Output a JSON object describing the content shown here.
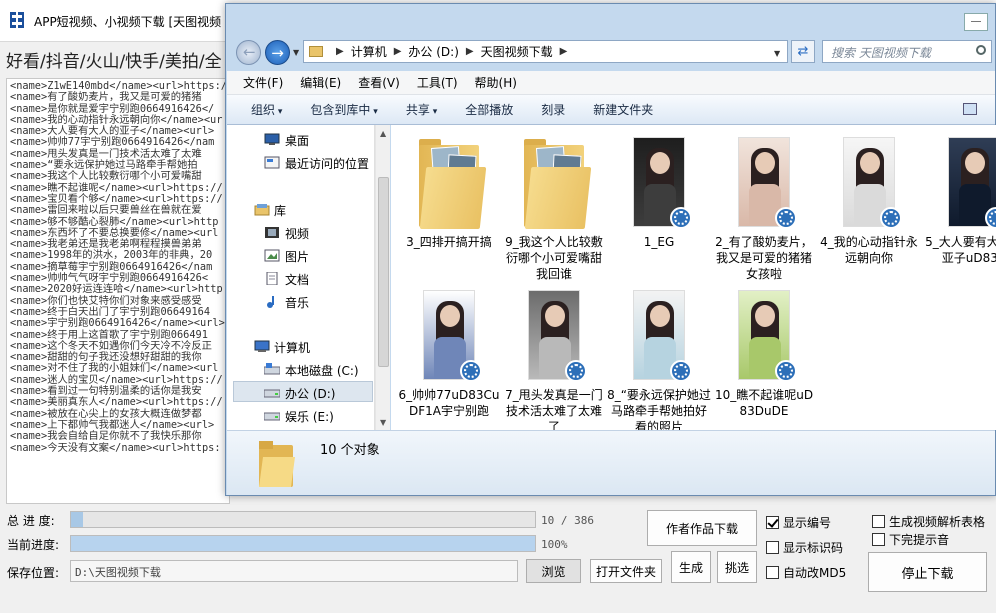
{
  "app": {
    "title": "APP短视频、小视频下载 [天图视频",
    "platforms": "好看/抖音/火山/快手/美拍/全",
    "log_lines": [
      "<name>Z1wE140mbd</name><url>https://",
      "<name>有了酸奶麦片，我又是可爱的猪猪",
      "<name>是你就是爱宇宁别跑0664916426</",
      "<name>我的心动指针永远朝向你</name><ur",
      "<name>大人要有大人的亚子</name><url>",
      "<name>帅帅77宇宁别跑0664916426</nam",
      "<name>甩头发真是一门技术活太难了太难",
      "<name>“要永远保护她过马路牵手帮她拍",
      "<name>我这个人比较敷衍哪个小可爱嘴甜",
      "<name>瞧不起谁呢</name><url>https://",
      "<name>宝贝看个够</name><url>https://",
      "<name>雷回来啦以后只要兽丝在兽就在爱",
      "<name>够不够酷心裂肺</name><url>http",
      "<name>东西坏了不要总换要修</name><url",
      "<name>我老弟还是我老弟啊程程摸兽弟弟",
      "<name>1998年的洪水，2003年的非典，20",
      "<name>摘草莓宇宁别跑0664916426</nam",
      "<name>帅帅气气呀宇宁别跑0664916426<",
      "<name>2020好运连连哈</name><url>http",
      "<name>你们也快艾特你们对象来感受感受",
      "<name>终于白天出门了宇宁别跑06649164",
      "<name>宇宁别跑0664916426</name><url>",
      "<name>终于用上这首歌了宇宁别跑066491",
      "<name>这个冬天不如遇你们今天冷不冷反正",
      "<name>甜甜的句子我还没想好甜甜的我你",
      "<name>对不住了我的小姐妹们</name><url",
      "<name>迷人的宝贝</name><url>https://",
      "<name>看到过一句特别温柔的话你是我安",
      "<name>美丽真东人</name><url>https://",
      "<name>被放在心尖上的女孩大概连做梦都",
      "<name>上下都帅气我都迷人</name><url>",
      "<name>我会自给自足你就不了我快乐那你",
      "<name>今天没有文案</name><url>https:"
    ],
    "total_progress_label": "总 进 度:",
    "total_progress_text": "10 / 386",
    "total_progress_fraction": 0.026,
    "current_progress_label": "当前进度:",
    "current_progress_text": "100%",
    "current_progress_fraction": 1.0,
    "save_label": "保存位置:",
    "save_path": "D:\\天图视频下载",
    "browse_button": "浏览",
    "open_folder_button": "打开文件夹",
    "author_works_button": "作者作品下载",
    "generate_button": "生成",
    "pick_button": "挑选",
    "stop_button": "停止下载",
    "checkboxes": [
      {
        "label": "显示编号",
        "checked": true
      },
      {
        "label": "显示标识码",
        "checked": false
      },
      {
        "label": "自动改MD5",
        "checked": false
      },
      {
        "label": "生成视频解析表格",
        "checked": false
      },
      {
        "label": "下完提示音",
        "checked": false
      }
    ]
  },
  "explorer": {
    "breadcrumb": [
      "计算机",
      "办公 (D:)",
      "天图视频下载"
    ],
    "search_placeholder": "搜索 天图视频下载",
    "menu": [
      "文件(F)",
      "编辑(E)",
      "查看(V)",
      "工具(T)",
      "帮助(H)"
    ],
    "toolbar": {
      "organize": "组织",
      "include": "包含到库中",
      "share": "共享",
      "play_all": "全部播放",
      "burn": "刻录",
      "new_folder": "新建文件夹"
    },
    "sidebar": {
      "desktop": "桌面",
      "recent": "最近访问的位置",
      "libraries": "库",
      "videos": "视频",
      "pictures": "图片",
      "documents": "文档",
      "music": "音乐",
      "computer": "计算机",
      "local_disk": "本地磁盘 (C:)",
      "office": "办公 (D:)",
      "entertainment": "娱乐 (E:)"
    },
    "items": [
      {
        "name": "3_四排开搞开搞",
        "kind": "folder"
      },
      {
        "name": "9_我这个人比较敷衍哪个小可爱嘴甜我回谁",
        "kind": "folder"
      },
      {
        "name": "1_EG",
        "kind": "video"
      },
      {
        "name": "2_有了酸奶麦片，我又是可爱的猪猪女孩啦",
        "kind": "video"
      },
      {
        "name": "4_我的心动指针永远朝向你",
        "kind": "video"
      },
      {
        "name": "5_大人要有大人的亚子uD83C",
        "kind": "video"
      },
      {
        "name": "6_帅帅77uD83CuDF1A宇宁别跑",
        "kind": "video"
      },
      {
        "name": "7_甩头发真是一门技术活太难了太难了",
        "kind": "video"
      },
      {
        "name": "8_“要永远保护她过马路牵手帮她拍好看的照片",
        "kind": "video"
      },
      {
        "name": "10_瞧不起谁呢uD83DuDE",
        "kind": "video"
      }
    ],
    "status": "10 个对象"
  }
}
